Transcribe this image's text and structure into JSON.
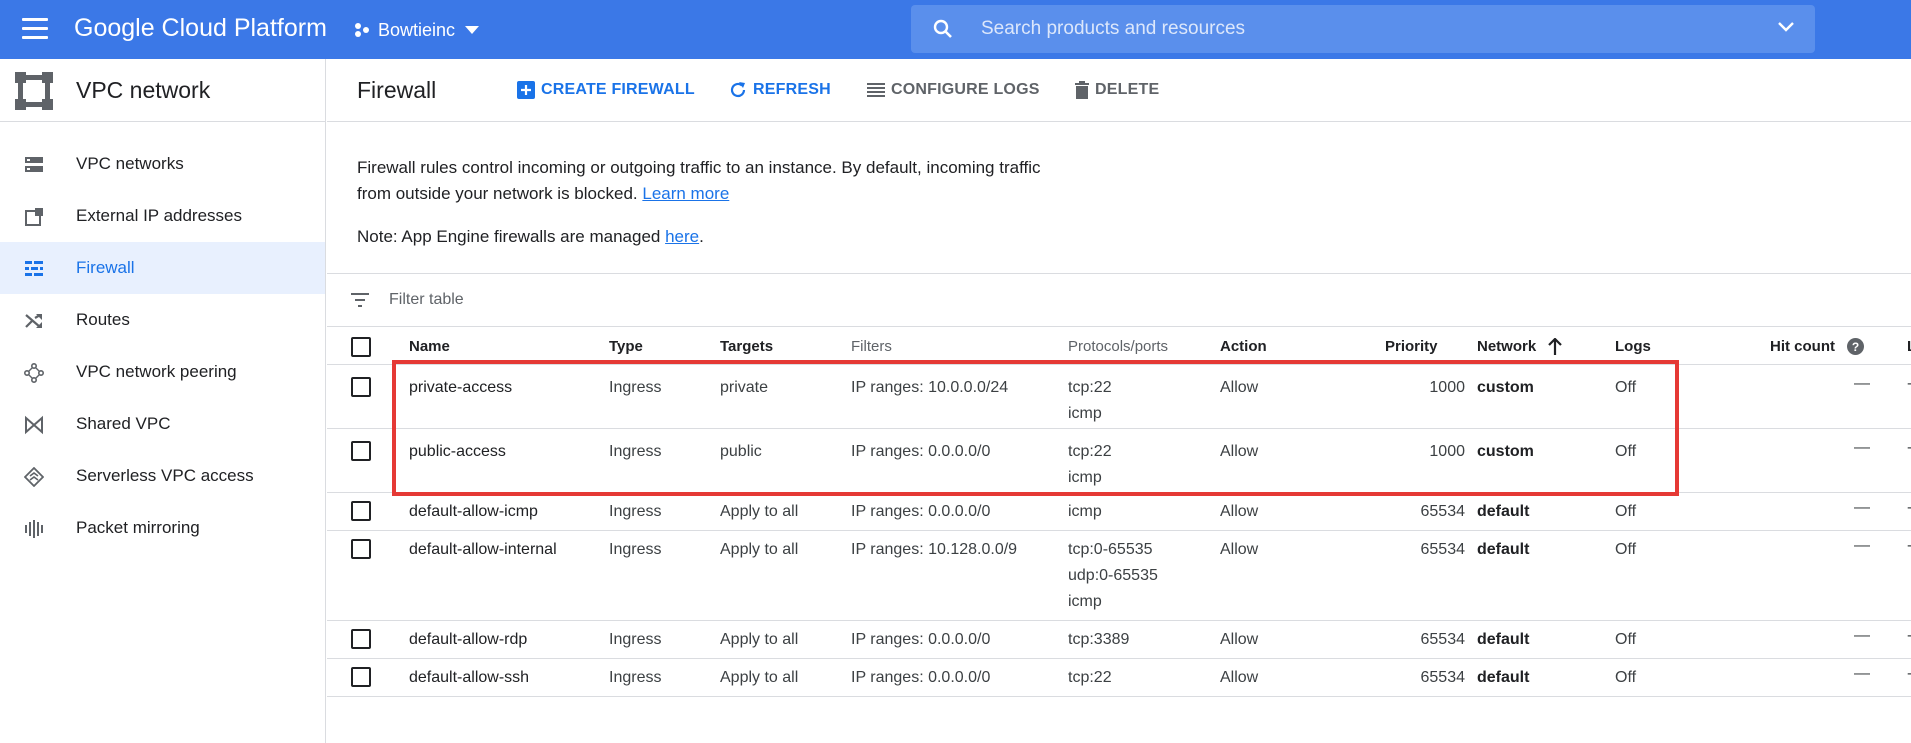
{
  "topbar": {
    "product_name": "Google Cloud Platform",
    "project": "Bowtieinc",
    "search_placeholder": "Search products and resources",
    "bar_color": "#3b78e7"
  },
  "sidebar": {
    "title": "VPC network",
    "items": [
      {
        "label": "VPC networks",
        "icon": "vpc-networks-icon",
        "active": false
      },
      {
        "label": "External IP addresses",
        "icon": "external-ip-icon",
        "active": false
      },
      {
        "label": "Firewall",
        "icon": "firewall-icon",
        "active": true
      },
      {
        "label": "Routes",
        "icon": "routes-icon",
        "active": false
      },
      {
        "label": "VPC network peering",
        "icon": "peering-icon",
        "active": false
      },
      {
        "label": "Shared VPC",
        "icon": "shared-vpc-icon",
        "active": false
      },
      {
        "label": "Serverless VPC access",
        "icon": "serverless-icon",
        "active": false
      },
      {
        "label": "Packet mirroring",
        "icon": "packet-mirroring-icon",
        "active": false
      }
    ]
  },
  "main": {
    "title": "Firewall",
    "actions": {
      "create": "CREATE FIREWALL",
      "refresh": "REFRESH",
      "configure_logs": "CONFIGURE LOGS",
      "delete": "DELETE"
    },
    "info_text": "Firewall rules control incoming or outgoing traffic to an instance. By default, incoming traffic from outside your network is blocked.",
    "learn_more": "Learn more",
    "note_prefix": "Note: App Engine firewalls are managed",
    "note_link": "here",
    "note_suffix": ".",
    "filter_placeholder": "Filter table"
  },
  "table": {
    "columns": {
      "name": "Name",
      "type": "Type",
      "targets": "Targets",
      "filters": "Filters",
      "protocols": "Protocols/ports",
      "action": "Action",
      "priority": "Priority",
      "network": "Network",
      "logs": "Logs",
      "hit_count": "Hit count",
      "last": "L"
    },
    "rows": [
      {
        "name": "private-access",
        "type": "Ingress",
        "targets": "private",
        "filters": "IP ranges: 10.0.0.0/24",
        "protocols": [
          "tcp:22",
          "icmp"
        ],
        "action": "Allow",
        "priority": "1000",
        "network": "custom",
        "logs": "Off",
        "hit_count": "—"
      },
      {
        "name": "public-access",
        "type": "Ingress",
        "targets": "public",
        "filters": "IP ranges: 0.0.0.0/0",
        "protocols": [
          "tcp:22",
          "icmp"
        ],
        "action": "Allow",
        "priority": "1000",
        "network": "custom",
        "logs": "Off",
        "hit_count": "—"
      },
      {
        "name": "default-allow-icmp",
        "type": "Ingress",
        "targets": "Apply to all",
        "filters": "IP ranges: 0.0.0.0/0",
        "protocols": [
          "icmp"
        ],
        "action": "Allow",
        "priority": "65534",
        "network": "default",
        "logs": "Off",
        "hit_count": "—"
      },
      {
        "name": "default-allow-internal",
        "type": "Ingress",
        "targets": "Apply to all",
        "filters": "IP ranges: 10.128.0.0/9",
        "protocols": [
          "tcp:0-65535",
          "udp:0-65535",
          "icmp"
        ],
        "action": "Allow",
        "priority": "65534",
        "network": "default",
        "logs": "Off",
        "hit_count": "—"
      },
      {
        "name": "default-allow-rdp",
        "type": "Ingress",
        "targets": "Apply to all",
        "filters": "IP ranges: 0.0.0.0/0",
        "protocols": [
          "tcp:3389"
        ],
        "action": "Allow",
        "priority": "65534",
        "network": "default",
        "logs": "Off",
        "hit_count": "—"
      },
      {
        "name": "default-allow-ssh",
        "type": "Ingress",
        "targets": "Apply to all",
        "filters": "IP ranges: 0.0.0.0/0",
        "protocols": [
          "tcp:22"
        ],
        "action": "Allow",
        "priority": "65534",
        "network": "default",
        "logs": "Off",
        "hit_count": "—"
      }
    ],
    "trailing_cell": "-"
  },
  "colors": {
    "accent": "#1a73e8",
    "highlight_box": "#e53935"
  }
}
